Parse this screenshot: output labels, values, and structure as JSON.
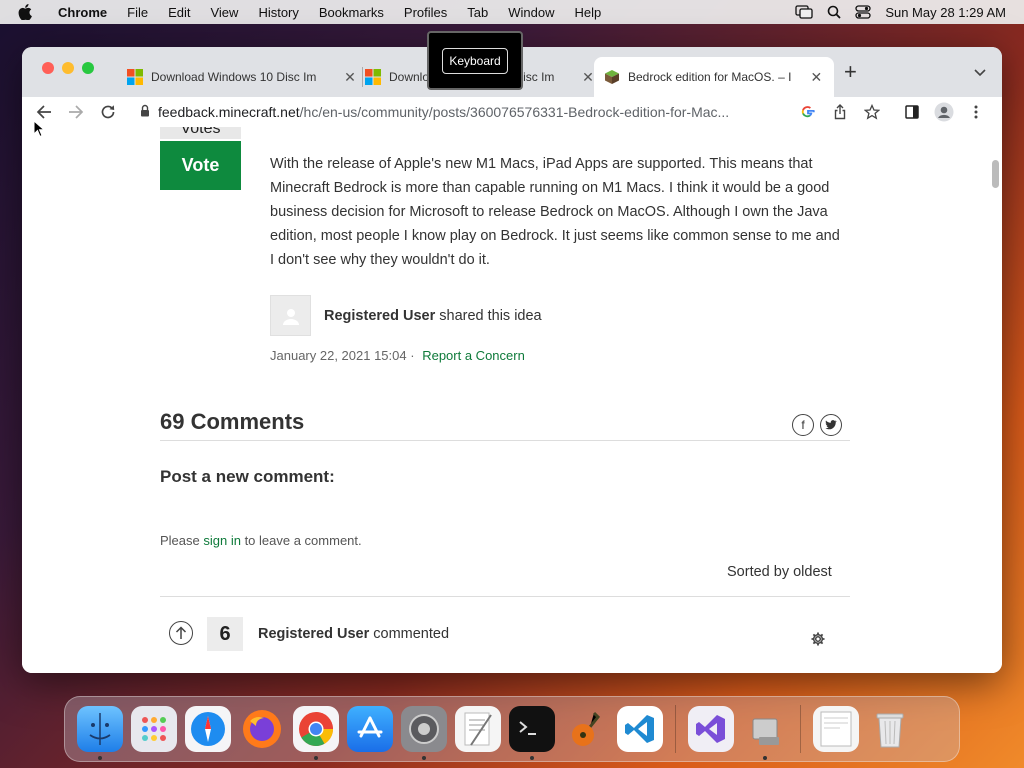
{
  "menubar": {
    "app": "Chrome",
    "items": [
      "File",
      "Edit",
      "View",
      "History",
      "Bookmarks",
      "Profiles",
      "Tab",
      "Window",
      "Help"
    ],
    "clock": "Sun May 28  1:29 AM"
  },
  "tabs": [
    {
      "label": "Download Windows 10 Disc Im",
      "favicon": "windows-icon"
    },
    {
      "label": "Download Windows 10 Disc Im",
      "favicon": "windows-icon"
    },
    {
      "label": "Bedrock edition for MacOS. – I",
      "favicon": "minecraft-icon",
      "active": true
    }
  ],
  "omnibox": {
    "host": "feedback.minecraft.net",
    "path": "/hc/en-us/community/posts/360076576331-Bedrock-edition-for-Mac..."
  },
  "overlay": {
    "keyboard_label": "Keyboard"
  },
  "post": {
    "votes_label": "Votes",
    "vote_button": "Vote",
    "body": "With the release of Apple's new M1 Macs, iPad Apps are supported. This means that Minecraft Bedrock is more than capable running on M1 Macs. I think it would be a good business decision for Microsoft to release Bedrock on MacOS. Although I own the Java edition, most people I know play on Bedrock. It just seems like common sense to me and I don't see why they wouldn't do it.",
    "author_name": "Registered User",
    "author_action": "shared this idea",
    "date": "January 22, 2021 15:04",
    "separator": "·",
    "report_link": "Report a Concern"
  },
  "comments": {
    "title": "69 Comments",
    "post_new_heading": "Post a new comment:",
    "signin_prefix": "Please ",
    "signin_link": "sign in",
    "signin_suffix": " to leave a comment.",
    "sorted": "Sorted by oldest",
    "first": {
      "votes": "6",
      "author": "Registered User",
      "action": "commented"
    }
  },
  "colors": {
    "accent_green": "#0e8a3e",
    "link_green": "#0e7a3a"
  }
}
